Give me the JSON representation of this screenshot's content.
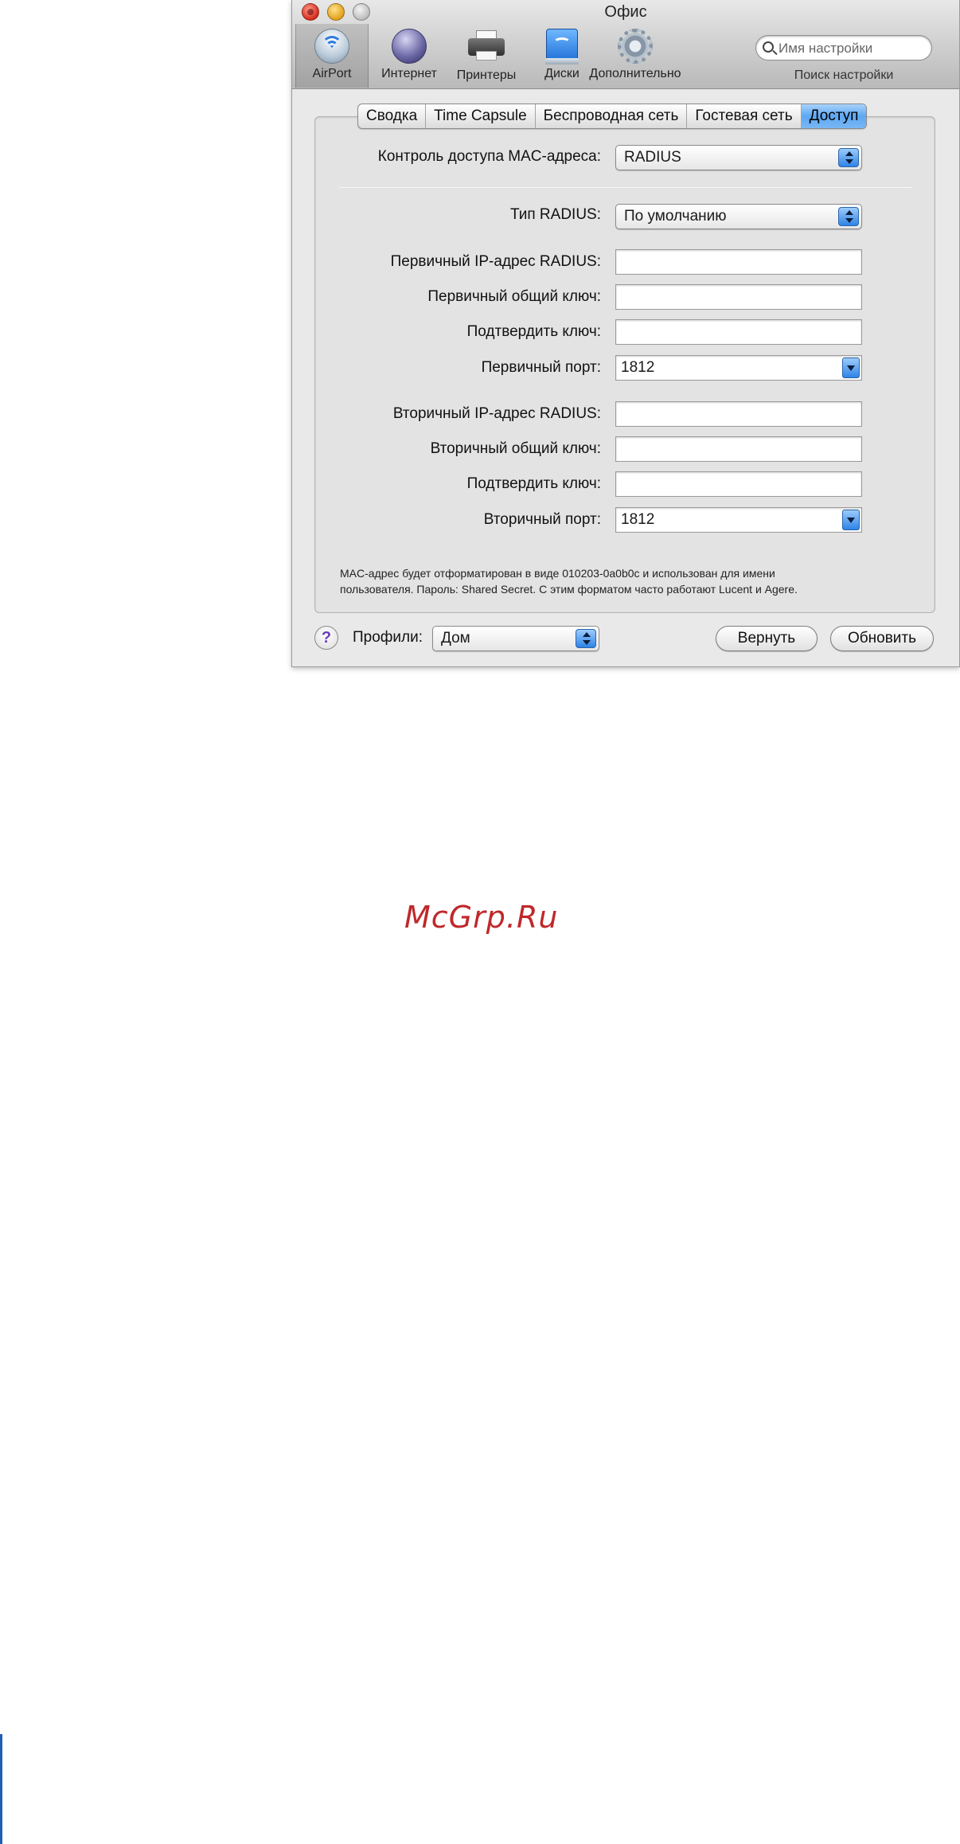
{
  "window": {
    "title": "Офис"
  },
  "toolbar": {
    "items": [
      {
        "label": "AirPort",
        "icon": "airport-icon",
        "selected": true
      },
      {
        "label": "Интернет",
        "icon": "globe-icon"
      },
      {
        "label": "Принтеры",
        "icon": "printer-icon"
      },
      {
        "label": "Диски",
        "icon": "disk-icon"
      },
      {
        "label": "Дополнительно",
        "icon": "gear-icon"
      }
    ],
    "search": {
      "placeholder": "Имя настройки",
      "caption": "Поиск настройки"
    }
  },
  "tabs": [
    {
      "label": "Сводка"
    },
    {
      "label": "Time Capsule"
    },
    {
      "label": "Беспроводная сеть"
    },
    {
      "label": "Гостевая сеть"
    },
    {
      "label": "Доступ",
      "active": true
    }
  ],
  "form": {
    "mac_control": {
      "label": "Контроль доступа MAC-адреса:",
      "value": "RADIUS"
    },
    "radius_type": {
      "label": "Тип RADIUS:",
      "value": "По умолчанию"
    },
    "primary_ip": {
      "label": "Первичный IP-адрес RADIUS:",
      "value": ""
    },
    "primary_secret": {
      "label": "Первичный общий ключ:",
      "value": ""
    },
    "primary_confirm": {
      "label": "Подтвердить ключ:",
      "value": ""
    },
    "primary_port": {
      "label": "Первичный порт:",
      "value": "1812"
    },
    "secondary_ip": {
      "label": "Вторичный IP-адрес RADIUS:",
      "value": ""
    },
    "secondary_secret": {
      "label": "Вторичный общий ключ:",
      "value": ""
    },
    "secondary_confirm": {
      "label": "Подтвердить ключ:",
      "value": ""
    },
    "secondary_port": {
      "label": "Вторичный порт:",
      "value": "1812"
    },
    "note_line1": "MAC-адрес будет отформатирован в виде 010203-0a0b0c и использован для имени",
    "note_line2": "пользователя. Пароль: Shared Secret. С этим форматом часто работают Lucent и Agere."
  },
  "bottom": {
    "help": "?",
    "profiles_label": "Профили:",
    "profile_value": "Дом",
    "revert_label": "Вернуть",
    "update_label": "Обновить"
  },
  "watermark": "McGrp.Ru",
  "colors": {
    "accent_blue": "#5ea7f2",
    "watermark_red": "#c0282b",
    "window_bg": "#e9e9e9"
  }
}
